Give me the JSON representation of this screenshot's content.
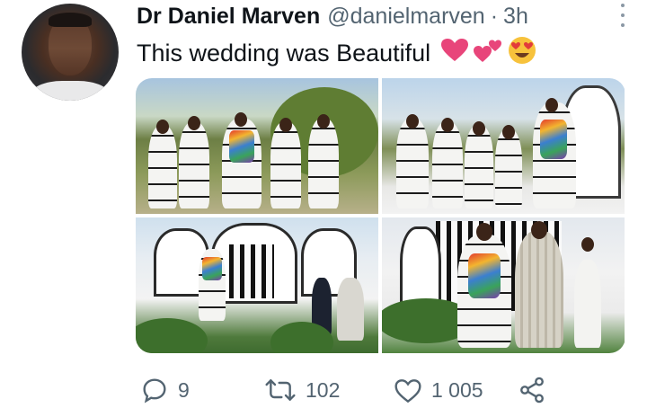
{
  "author": {
    "display_name": "Dr Daniel Marven",
    "handle": "@danielmarven",
    "separator": "·",
    "time": "3h",
    "avatar_icon": "profile-photo"
  },
  "tweet": {
    "text": "This wedding was Beautiful",
    "emojis": [
      "heart-emoji",
      "two-hearts-emoji",
      "heart-eyes-emoji"
    ]
  },
  "media": {
    "photo_count": 4,
    "photos": [
      "bridesmaids-photo",
      "procession-photo",
      "ceremony-photo",
      "couple-photo"
    ]
  },
  "actions": {
    "reply_count": "9",
    "retweet_count": "102",
    "like_count": "1 005",
    "icons": [
      "reply-icon",
      "retweet-icon",
      "like-icon",
      "share-icon"
    ]
  },
  "colors": {
    "text": "#0f1419",
    "secondary": "#536471",
    "heart": "#e8457a",
    "emoji_yellow": "#f7c23c"
  }
}
